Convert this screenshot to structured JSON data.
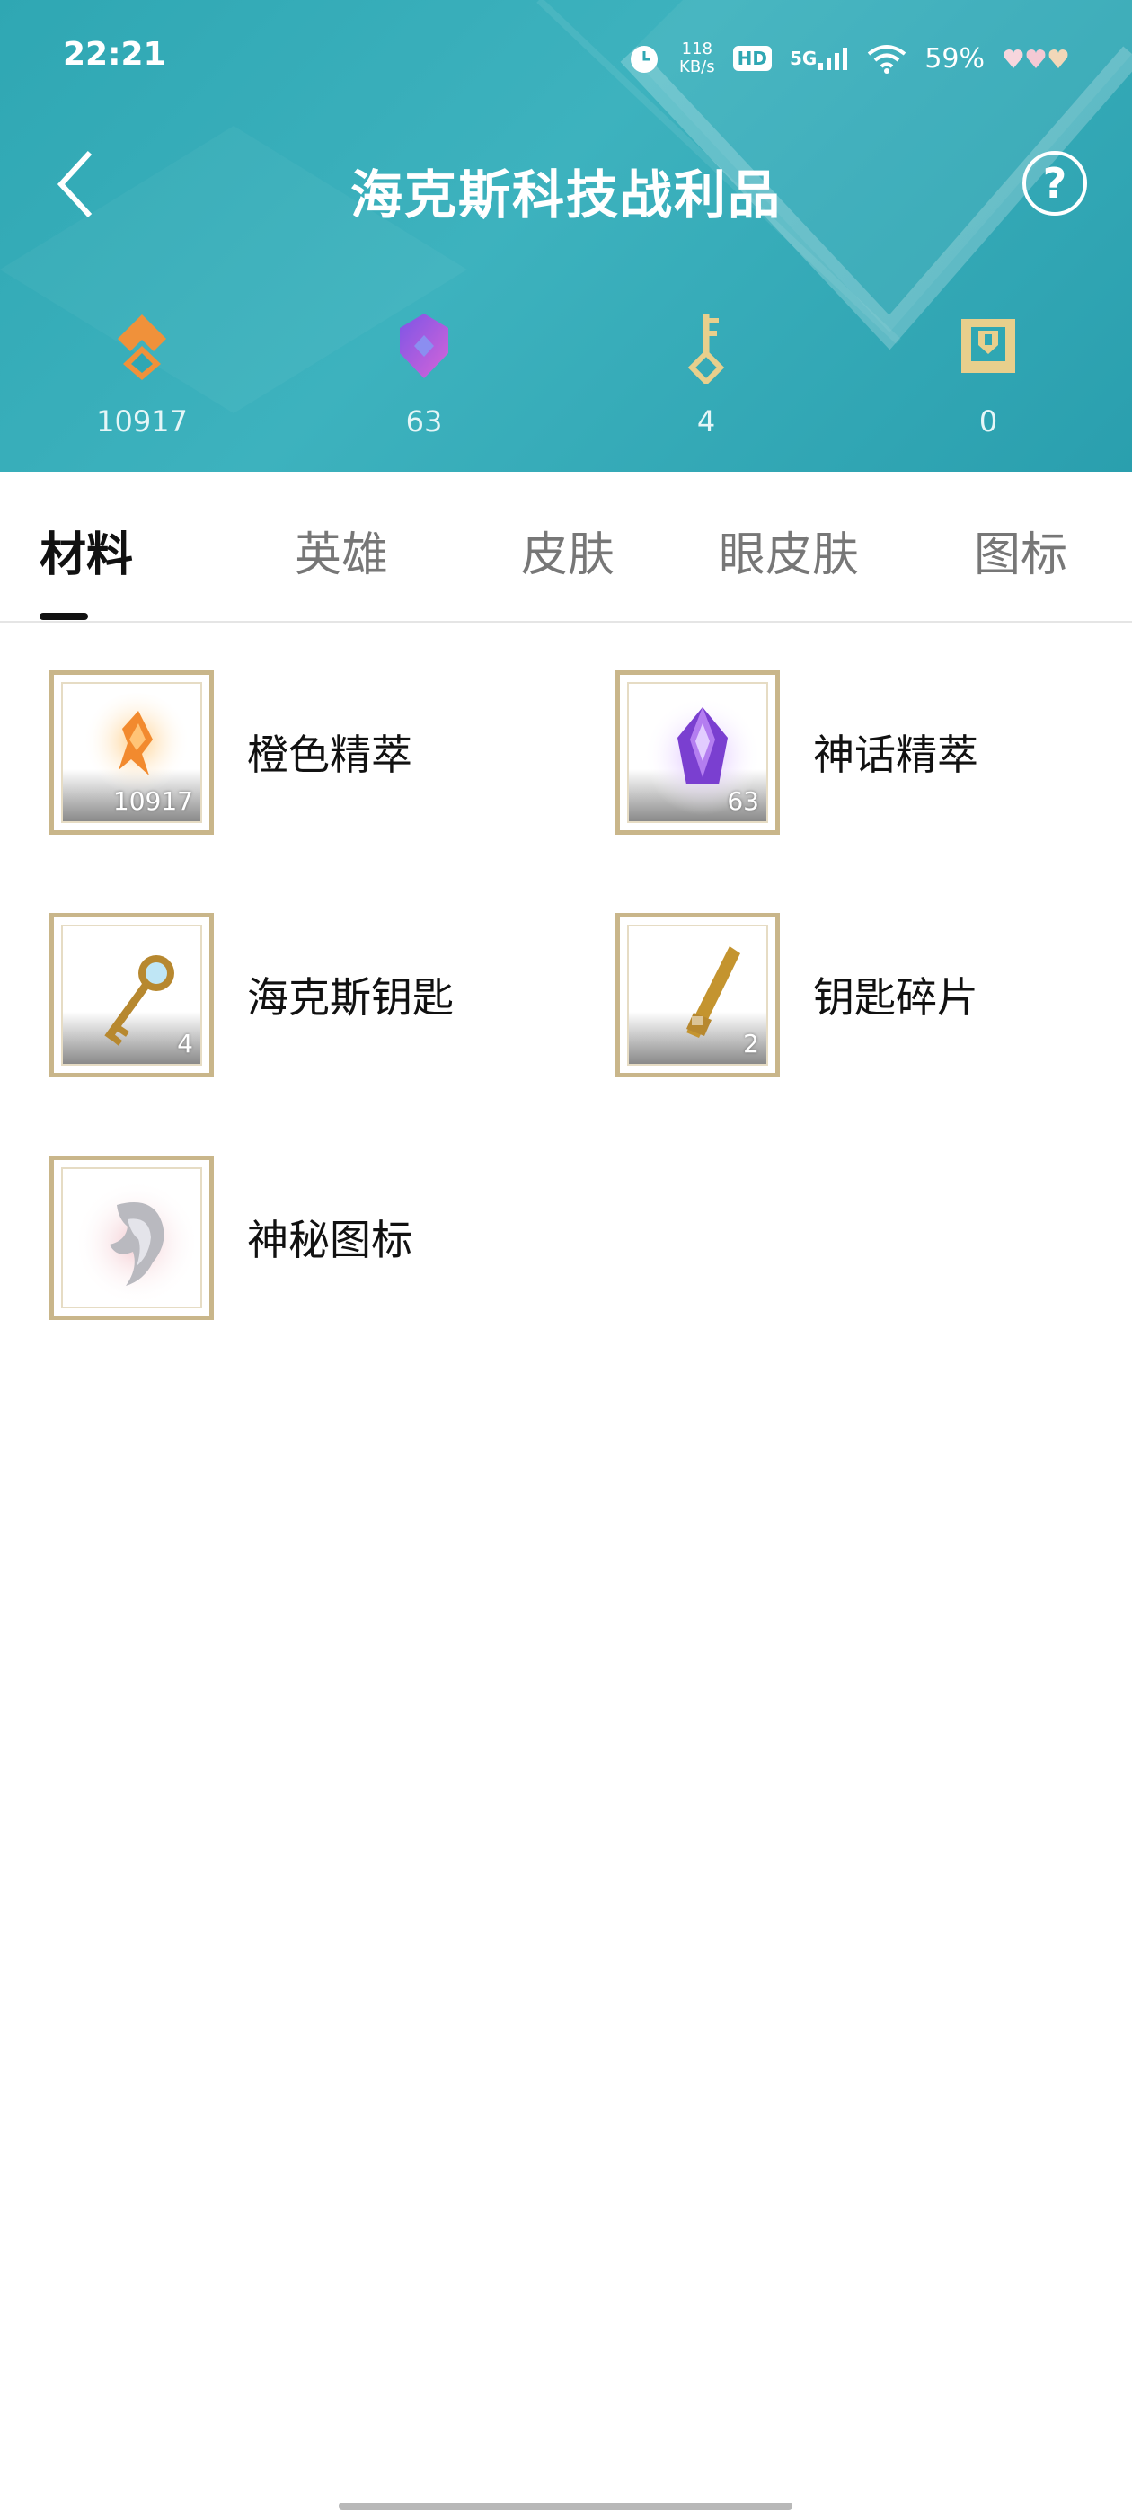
{
  "status_bar": {
    "time": "22:21",
    "net_speed_value": "118",
    "net_speed_unit": "KB/s",
    "hd_label": "HD",
    "signal_label": "5G",
    "battery": "59%"
  },
  "nav": {
    "title": "海克斯科技战利品"
  },
  "currencies": [
    {
      "icon": "orange-essence-icon",
      "value": "10917",
      "color": "#f0913a"
    },
    {
      "icon": "mythic-essence-icon",
      "value": "63",
      "color": "#a45ee0"
    },
    {
      "icon": "hextech-key-icon",
      "value": "4",
      "color": "#e8cf8c"
    },
    {
      "icon": "chest-icon",
      "value": "0",
      "color": "#e8cf8c"
    }
  ],
  "tabs": [
    {
      "label": "材料",
      "active": true
    },
    {
      "label": "英雄",
      "active": false
    },
    {
      "label": "皮肤",
      "active": false
    },
    {
      "label": "眼皮肤",
      "active": false
    },
    {
      "label": "图标",
      "active": false
    }
  ],
  "items": [
    {
      "label": "橙色精萃",
      "count": "10917",
      "icon": "orange-essence-icon"
    },
    {
      "label": "神话精萃",
      "count": "63",
      "icon": "mythic-essence-icon"
    },
    {
      "label": "海克斯钥匙",
      "count": "4",
      "icon": "hextech-key-icon"
    },
    {
      "label": "钥匙碎片",
      "count": "2",
      "icon": "key-fragment-icon"
    },
    {
      "label": "神秘图标",
      "count": "",
      "icon": "mystery-icon-icon"
    }
  ],
  "colors": {
    "header_teal": "#2fa7b3",
    "frame_gold": "#c9b68a"
  }
}
